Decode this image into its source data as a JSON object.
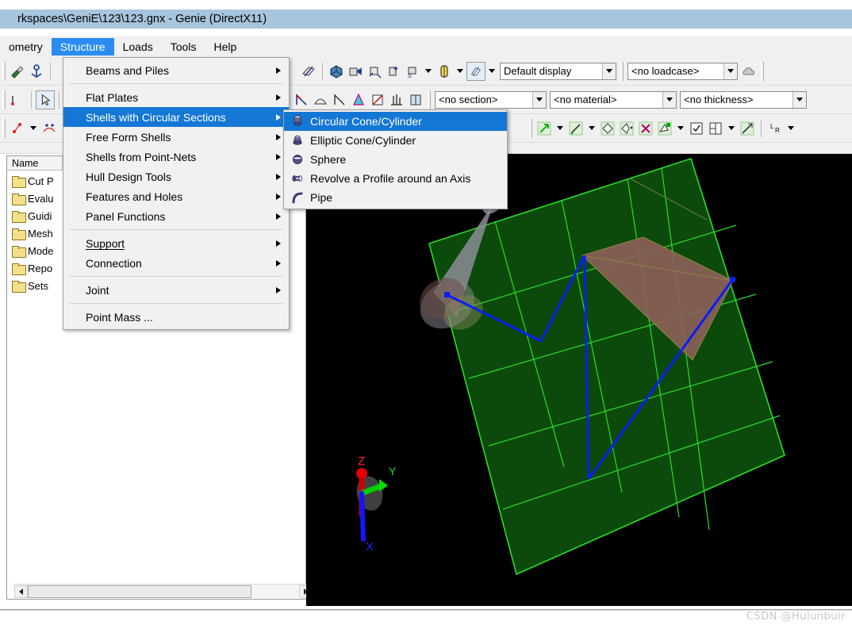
{
  "window": {
    "title": "rkspaces\\GeniE\\123\\123.gnx - Genie (DirectX11)"
  },
  "menubar": {
    "items": [
      {
        "label": "ometry",
        "active": false
      },
      {
        "label": "Structure",
        "active": true
      },
      {
        "label": "Loads",
        "active": false
      },
      {
        "label": "Tools",
        "active": false
      },
      {
        "label": "Help",
        "active": false
      }
    ]
  },
  "toolbar": {
    "display_combo": {
      "value": "Default display",
      "name": "display-combo"
    },
    "loadcase_combo": {
      "value": "<no loadcase>",
      "name": "loadcase-combo"
    },
    "section_combo": {
      "value": "<no section>",
      "name": "section-combo"
    },
    "material_combo": {
      "value": "<no material>",
      "name": "material-combo"
    },
    "thickness_combo": {
      "value": "<no thickness>",
      "name": "thickness-combo"
    },
    "row1_icons": [
      "paint-brush-icon",
      "solid-cube-icon",
      "cube-extrude-icon",
      "rotate-cube-icon",
      "cube-add-icon",
      "cube-shade-icon",
      "wireframe-cube-icon",
      "cut-plane-icon"
    ],
    "row2_icons": [
      "beam-select-icon",
      "shell-select-icon",
      "node-select-icon",
      "support-select-icon",
      "plate-select-icon",
      "pile-select-icon",
      "structure-select-icon"
    ],
    "row3_icons": [
      "mesh-arrow-icon",
      "mesh-point-icon",
      "mesh-expand-icon",
      "mesh-node-icon",
      "mesh-delete-icon",
      "mesh-fill-icon",
      "mesh-check-icon",
      "mesh-split-icon",
      "mesh-hide-icon",
      "local-axes-icon"
    ],
    "cloud_icon": "cloud-icon"
  },
  "tree": {
    "header": "Name",
    "items": [
      {
        "label": "Cut P",
        "icon": "folder-icon"
      },
      {
        "label": "Evalu",
        "icon": "folder-icon"
      },
      {
        "label": "Guidi",
        "icon": "folder-icon"
      },
      {
        "label": "Mesh",
        "icon": "folder-icon"
      },
      {
        "label": "Mode",
        "icon": "folder-icon"
      },
      {
        "label": "Repo",
        "icon": "folder-icon"
      },
      {
        "label": "Sets",
        "icon": "folder-icon"
      }
    ]
  },
  "structure_menu": {
    "items": [
      {
        "label": "Beams and Piles",
        "submenu": true,
        "selected": false,
        "sep_after": true
      },
      {
        "label": "Flat Plates",
        "submenu": true,
        "selected": false
      },
      {
        "label": "Shells with Circular Sections",
        "submenu": true,
        "selected": true
      },
      {
        "label": "Free Form Shells",
        "submenu": true,
        "selected": false
      },
      {
        "label": "Shells from Point-Nets",
        "submenu": true,
        "selected": false
      },
      {
        "label": "Hull Design Tools",
        "submenu": true,
        "selected": false
      },
      {
        "label": "Features and Holes",
        "submenu": true,
        "selected": false
      },
      {
        "label": "Panel Functions",
        "submenu": true,
        "selected": false,
        "sep_after": true
      },
      {
        "label": "Support",
        "submenu": true,
        "selected": false,
        "mnemonic": "S"
      },
      {
        "label": "Connection",
        "submenu": true,
        "selected": false,
        "mnemonic": "C",
        "sep_after": true
      },
      {
        "label": "Joint",
        "submenu": true,
        "selected": false,
        "mnemonic": "J",
        "sep_after": true
      },
      {
        "label": "Point Mass ...",
        "submenu": false,
        "selected": false,
        "mnemonic": "M"
      }
    ]
  },
  "circular_sections_submenu": {
    "items": [
      {
        "label": "Circular Cone/Cylinder",
        "icon": "cylinder-icon",
        "selected": true
      },
      {
        "label": "Elliptic Cone/Cylinder",
        "icon": "elliptic-cylinder-icon",
        "selected": false
      },
      {
        "label": "Sphere",
        "icon": "sphere-icon",
        "selected": false
      },
      {
        "label": "Revolve a Profile around an Axis",
        "icon": "revolve-icon",
        "selected": false
      },
      {
        "label": "Pipe",
        "icon": "pipe-icon",
        "selected": false
      }
    ]
  },
  "viewport": {
    "background": "#000000",
    "mesh_color": "#00d000",
    "mesh_fill": "#0b4a0b",
    "beam_color": "#0000ff",
    "shell_fill": "#8a6058",
    "cone_color": "#8c8c96",
    "axes": [
      {
        "label": "Z",
        "color": "#ff0000"
      },
      {
        "label": "Y",
        "color": "#00c000"
      },
      {
        "label": "X",
        "color": "#0000ff"
      }
    ]
  },
  "watermark": {
    "text": "CSDN @Hulunbuir"
  }
}
